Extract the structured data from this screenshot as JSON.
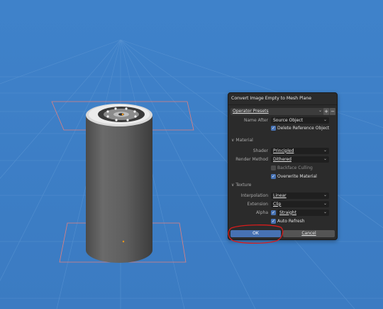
{
  "dialog": {
    "title": "Convert Image Empty to Mesh Plane",
    "presets": {
      "label": "Operator Presets",
      "add": "+",
      "remove": "−"
    },
    "name_after": {
      "label": "Name After",
      "value": "Source Object"
    },
    "delete_reference": {
      "label": "Delete Reference Object",
      "checked": true
    },
    "material_section": "Material",
    "shader": {
      "label": "Shader",
      "value": "Principled"
    },
    "render_method": {
      "label": "Render Method",
      "value": "Dithered"
    },
    "backface_culling": {
      "label": "Backface Culling",
      "checked": false
    },
    "overwrite_material": {
      "label": "Overwrite Material",
      "checked": true
    },
    "texture_section": "Texture",
    "interpolation": {
      "label": "Interpolation",
      "value": "Linear"
    },
    "extension": {
      "label": "Extension",
      "value": "Clip"
    },
    "alpha": {
      "label": "Alpha",
      "value": "Straight",
      "checked": true
    },
    "auto_refresh": {
      "label": "Auto Refresh",
      "checked": true
    },
    "ok": "OK",
    "cancel": "Cancel"
  },
  "icons": {
    "checkmark": "✓",
    "chevron": "⌄",
    "section_arrow": "∨"
  },
  "colors": {
    "viewport_bg": "#3d7fc7",
    "accent": "#4772b3",
    "annotation": "#d81c1c"
  }
}
